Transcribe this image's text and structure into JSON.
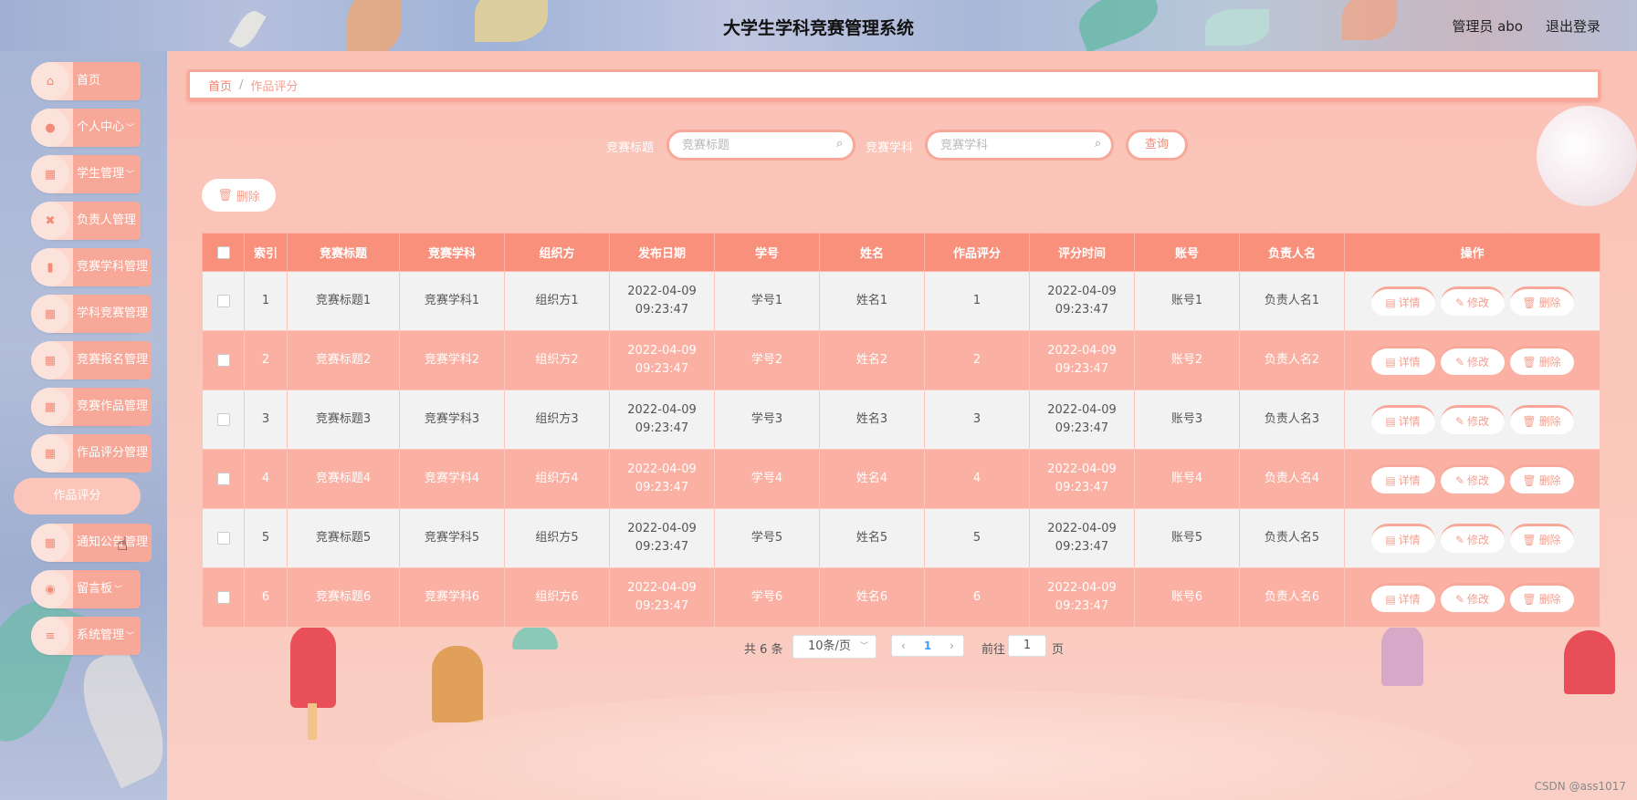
{
  "header": {
    "title": "大学生学科竞赛管理系统",
    "user": "管理员 abo",
    "logout": "退出登录"
  },
  "sidebar": {
    "items": [
      {
        "label": "首页",
        "icon": "home-icon",
        "arrow": ""
      },
      {
        "label": "个人中心",
        "icon": "user-icon",
        "arrow": "﹀"
      },
      {
        "label": "学生管理",
        "icon": "grid-icon",
        "arrow": "﹀"
      },
      {
        "label": "负责人管理",
        "icon": "ticket-icon",
        "arrow": ""
      },
      {
        "label": "竞赛学科管理",
        "icon": "clipboard-icon",
        "arrow": ""
      },
      {
        "label": "学科竞赛管理",
        "icon": "grid-icon",
        "arrow": ""
      },
      {
        "label": "竞赛报名管理",
        "icon": "grid-icon",
        "arrow": ""
      },
      {
        "label": "竞赛作品管理",
        "icon": "grid-icon",
        "arrow": ""
      },
      {
        "label": "作品评分管理",
        "icon": "grid-icon",
        "arrow": ""
      },
      {
        "label": "通知公告管理",
        "icon": "grid-icon",
        "arrow": ""
      },
      {
        "label": "留言板",
        "icon": "location-icon",
        "arrow": "﹀"
      },
      {
        "label": "系统管理",
        "icon": "menu-icon",
        "arrow": "﹀"
      }
    ],
    "sub_item": "作品评分"
  },
  "breadcrumb": {
    "home": "首页",
    "sep": "/",
    "current": "作品评分"
  },
  "search": {
    "title_label": "竞赛标题",
    "title_placeholder": "竞赛标题",
    "subject_label": "竞赛学科",
    "subject_placeholder": "竞赛学科",
    "query_button": "查询"
  },
  "toolbar": {
    "delete_button": "删除"
  },
  "table": {
    "headers": [
      "索引",
      "竞赛标题",
      "竞赛学科",
      "组织方",
      "发布日期",
      "学号",
      "姓名",
      "作品评分",
      "评分时间",
      "账号",
      "负责人名",
      "操作"
    ],
    "rows": [
      [
        "1",
        "竞赛标题1",
        "竞赛学科1",
        "组织方1",
        "2022-04-09 09:23:47",
        "学号1",
        "姓名1",
        "1",
        "2022-04-09 09:23:47",
        "账号1",
        "负责人名1"
      ],
      [
        "2",
        "竞赛标题2",
        "竞赛学科2",
        "组织方2",
        "2022-04-09 09:23:47",
        "学号2",
        "姓名2",
        "2",
        "2022-04-09 09:23:47",
        "账号2",
        "负责人名2"
      ],
      [
        "3",
        "竞赛标题3",
        "竞赛学科3",
        "组织方3",
        "2022-04-09 09:23:47",
        "学号3",
        "姓名3",
        "3",
        "2022-04-09 09:23:47",
        "账号3",
        "负责人名3"
      ],
      [
        "4",
        "竞赛标题4",
        "竞赛学科4",
        "组织方4",
        "2022-04-09 09:23:47",
        "学号4",
        "姓名4",
        "4",
        "2022-04-09 09:23:47",
        "账号4",
        "负责人名4"
      ],
      [
        "5",
        "竞赛标题5",
        "竞赛学科5",
        "组织方5",
        "2022-04-09 09:23:47",
        "学号5",
        "姓名5",
        "5",
        "2022-04-09 09:23:47",
        "账号5",
        "负责人名5"
      ],
      [
        "6",
        "竞赛标题6",
        "竞赛学科6",
        "组织方6",
        "2022-04-09 09:23:47",
        "学号6",
        "姓名6",
        "6",
        "2022-04-09 09:23:47",
        "账号6",
        "负责人名6"
      ]
    ],
    "actions": {
      "detail": "详情",
      "edit": "修改",
      "delete": "删除"
    }
  },
  "pagination": {
    "total": "共 6 条",
    "page_size": "10条/页",
    "current_page": "1",
    "goto_label": "前往",
    "goto_value": "1",
    "page_word": "页"
  },
  "watermark": "CSDN @ass1017",
  "colors": {
    "accent": "#f9907c",
    "accent_light": "#fab0a2",
    "page_bg": "#fbc2b6"
  }
}
